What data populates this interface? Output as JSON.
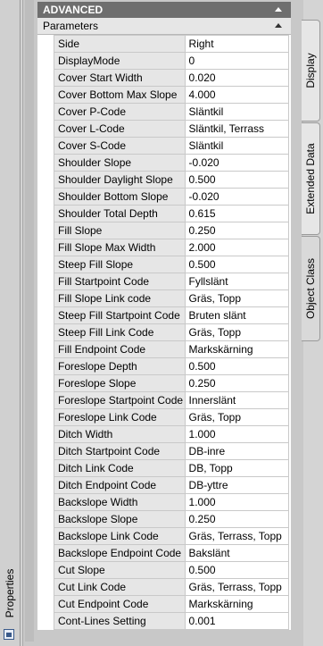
{
  "palette": {
    "header_bg": "#6e6e6e",
    "subheader_bg": "#e6e6e6",
    "name_cell_bg": "#e6e6e6",
    "value_cell_bg": "#ffffff"
  },
  "left_strip": {
    "label": "Properties",
    "pin_icon": "properties-pin-icon"
  },
  "section": {
    "title": "ADVANCED",
    "collapse_icon": "collapse-arrow-icon",
    "subsection": {
      "title": "Parameters",
      "collapse_icon": "collapse-arrow-icon"
    }
  },
  "properties": [
    {
      "name": "Side",
      "value": "Right"
    },
    {
      "name": "DisplayMode",
      "value": "0"
    },
    {
      "name": "Cover Start Width",
      "value": "0.020"
    },
    {
      "name": "Cover Bottom Max Slope",
      "value": "4.000"
    },
    {
      "name": "Cover P-Code",
      "value": "Släntkil"
    },
    {
      "name": "Cover L-Code",
      "value": "Släntkil, Terrass"
    },
    {
      "name": "Cover S-Code",
      "value": "Släntkil"
    },
    {
      "name": "Shoulder Slope",
      "value": "-0.020"
    },
    {
      "name": "Shoulder Daylight Slope",
      "value": "0.500"
    },
    {
      "name": "Shoulder Bottom Slope",
      "value": "-0.020"
    },
    {
      "name": "Shoulder Total Depth",
      "value": "0.615"
    },
    {
      "name": "Fill Slope",
      "value": "0.250"
    },
    {
      "name": "Fill Slope Max Width",
      "value": "2.000"
    },
    {
      "name": "Steep Fill Slope",
      "value": "0.500"
    },
    {
      "name": "Fill Startpoint Code",
      "value": "Fyllslänt"
    },
    {
      "name": "Fill Slope Link code",
      "value": "Gräs, Topp"
    },
    {
      "name": "Steep Fill Startpoint Code",
      "value": "Bruten slänt"
    },
    {
      "name": "Steep Fill Link Code",
      "value": "Gräs, Topp"
    },
    {
      "name": "Fill Endpoint Code",
      "value": "Markskärning"
    },
    {
      "name": "Foreslope Depth",
      "value": "0.500"
    },
    {
      "name": "Foreslope Slope",
      "value": "0.250"
    },
    {
      "name": "Foreslope Startpoint Code",
      "value": "Innerslänt"
    },
    {
      "name": "Foreslope Link Code",
      "value": "Gräs, Topp"
    },
    {
      "name": "Ditch Width",
      "value": "1.000"
    },
    {
      "name": "Ditch Startpoint Code",
      "value": "DB-inre"
    },
    {
      "name": "Ditch Link Code",
      "value": "DB, Topp"
    },
    {
      "name": "Ditch Endpoint Code",
      "value": "DB-yttre"
    },
    {
      "name": "Backslope Width",
      "value": "1.000"
    },
    {
      "name": "Backslope Slope",
      "value": "0.250"
    },
    {
      "name": "Backslope Link Code",
      "value": "Gräs, Terrass, Topp"
    },
    {
      "name": "Backslope Endpoint Code",
      "value": "Bakslänt"
    },
    {
      "name": "Cut Slope",
      "value": "0.500"
    },
    {
      "name": "Cut Link Code",
      "value": "Gräs, Terrass, Topp"
    },
    {
      "name": "Cut Endpoint Code",
      "value": "Markskärning"
    },
    {
      "name": "Cont-Lines Setting",
      "value": "0.001"
    }
  ],
  "right_tabs": [
    {
      "label": "Display"
    },
    {
      "label": "Extended Data"
    },
    {
      "label": "Object Class"
    }
  ]
}
